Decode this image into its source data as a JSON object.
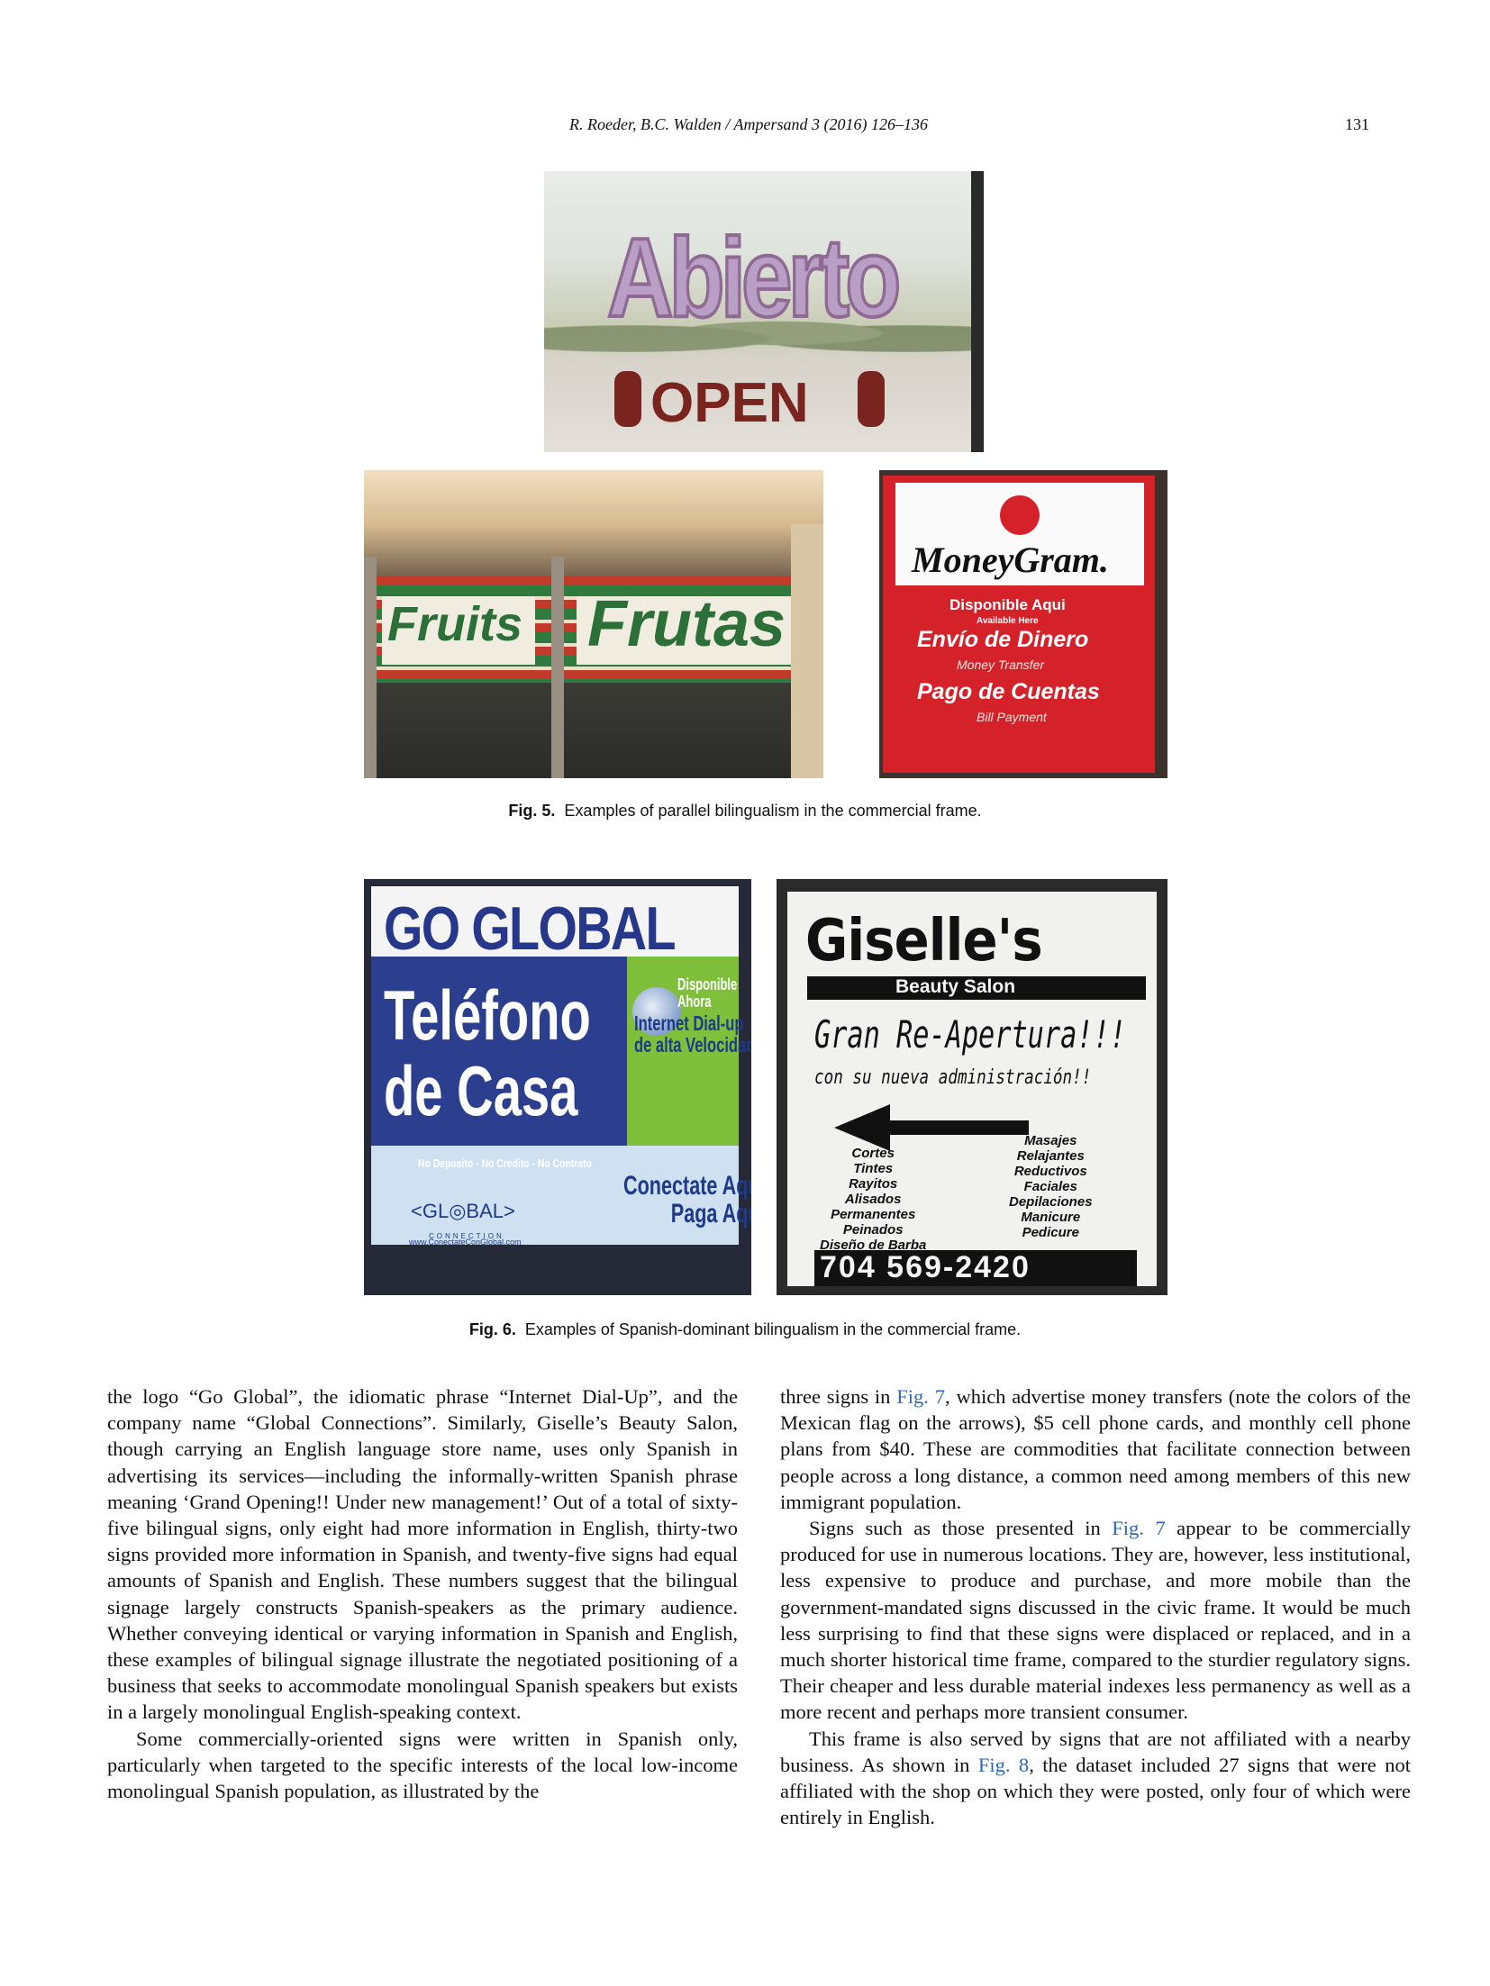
{
  "header": {
    "running_head": "R. Roeder, B.C. Walden / Ampersand 3 (2016) 126–136",
    "page_number": "131"
  },
  "figure5": {
    "photo_abierto": {
      "big": "Abierto",
      "small": "OPEN"
    },
    "photo_frutas": {
      "left": "Fruits",
      "right": "Frutas"
    },
    "photo_moneygram": {
      "brand": "MoneyGram.",
      "line1": "Disponible Aqui",
      "line1_sub": "Available Here",
      "line2": "Envío de Dinero",
      "line2_sub": "Money Transfer",
      "line3": "Pago de Cuentas",
      "line3_sub": "Bill Payment"
    },
    "label": "Fig. 5.",
    "caption": "Examples of parallel bilingualism in the commercial frame."
  },
  "figure6": {
    "photo_goglobal": {
      "headline": "GO GLOBAL",
      "line1": "Teléfono",
      "line2": "de Casa",
      "fine": "No Deposito - No Credito - No Contrato",
      "green_top": "Disponible\nAhora",
      "green_mid": "Internet Dial-up\nde alta Velocidad",
      "bottom_right": "Conectate Aqui.\nPaga Aqui.",
      "logo": "<GL◎BAL>",
      "logo_sub": "CONNECTION",
      "url": "www.ConectateConGlobal.com"
    },
    "photo_giselle": {
      "brand": "Giselle's",
      "band": "Beauty Salon",
      "hand1": "Gran Re-Apertura!!!",
      "hand2": "con su nueva administración!!",
      "list_left": "Cortes\nTintes\nRayitos\nAlisados\nPermanentes\nPeinados\nDiseño de Barba",
      "list_right": "Masajes\nRelajantes\nReductivos\nFaciales\nDepilaciones\nManicure\nPedicure",
      "phone": "704 569-2420"
    },
    "label": "Fig. 6.",
    "caption": "Examples of Spanish-dominant bilingualism in the commercial frame."
  },
  "body": {
    "left_p1": "the logo “Go Global”, the idiomatic phrase “Internet Dial-Up”, and the company name “Global Connections”. Similarly, Giselle’s Beauty Salon, though carrying an English language store name, uses only Spanish in advertising its services—including the informally-written Spanish phrase meaning ‘Grand Opening!! Under new management!’ Out of a total of sixty-five bilingual signs, only eight had more information in English, thirty-two signs provided more information in Spanish, and twenty-five signs had equal amounts of Spanish and English. These numbers suggest that the bilingual signage largely constructs Spanish-speakers as the primary audience. Whether conveying identical or varying information in Spanish and English, these examples of bilingual signage illustrate the negotiated positioning of a business that seeks to accommodate monolingual Spanish speakers but exists in a largely monolingual English-speaking context.",
    "left_p2": "Some commercially-oriented signs were written in Spanish only, particularly when targeted to the specific interests of the local low-income monolingual Spanish population, as illustrated by the",
    "right_p1_a": "three signs in ",
    "right_p1_ref": "Fig. 7",
    "right_p1_b": ", which advertise money transfers (note the colors of the Mexican flag on the arrows), $5 cell phone cards, and monthly cell phone plans from $40. These are commodities that facilitate connection between people across a long distance, a common need among members of this new immigrant population.",
    "right_p2_a": "Signs such as those presented in ",
    "right_p2_ref": "Fig. 7",
    "right_p2_b": " appear to be commercially produced for use in numerous locations. They are, however, less institutional, less expensive to produce and purchase, and more mobile than the government-mandated signs discussed in the civic frame. It would be much less surprising to find that these signs were displaced or replaced, and in a much shorter historical time frame, compared to the sturdier regulatory signs. Their cheaper and less durable material indexes less permanency as well as a more recent and perhaps more transient consumer.",
    "right_p3_a": "This frame is also served by signs that are not affiliated with a nearby business. As shown in ",
    "right_p3_ref": "Fig. 8",
    "right_p3_b": ", the dataset included 27 signs that were not affiliated with the shop on which they were posted, only four of which were entirely in English."
  }
}
